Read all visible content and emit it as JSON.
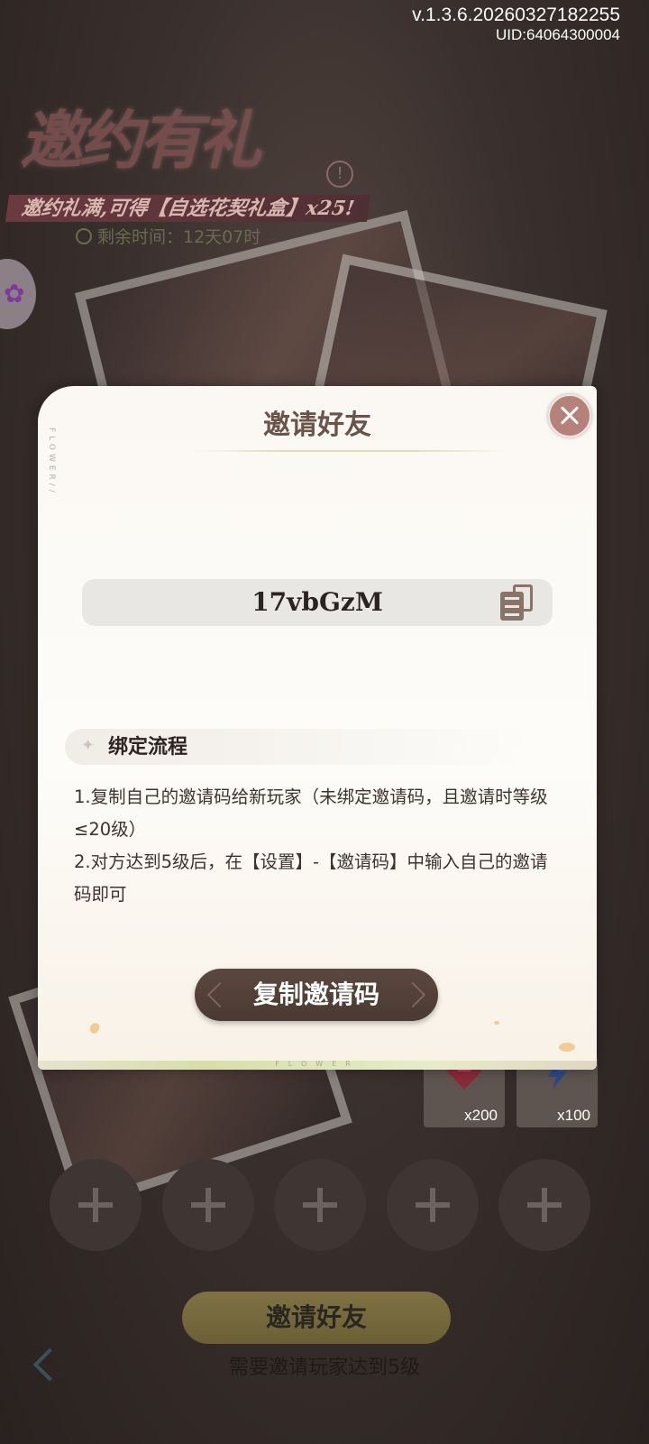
{
  "header": {
    "version": "v.1.3.6.20260327182255",
    "uid": "UID:64064300004"
  },
  "event": {
    "title": "邀约有礼",
    "info_mark": "!",
    "subtitle": "邀约礼满,可得【自选花契礼盒】x25!",
    "time_remaining": "剩余时间：12天07时"
  },
  "rewards": [
    {
      "icon": "ruby-gem-icon",
      "count": "x200"
    },
    {
      "icon": "lightning-icon",
      "count": "x100"
    }
  ],
  "invite_slots": [
    "+",
    "+",
    "+",
    "+",
    "+"
  ],
  "footer": {
    "invite_button": "邀请好友",
    "hint": "需要邀请玩家达到5级"
  },
  "dialog": {
    "title": "邀请好友",
    "invite_code": "17vbGzM",
    "section_title": "绑定流程",
    "rule_1": "1.复制自己的邀请码给新玩家（未绑定邀请码，且邀请时等级≤20级）",
    "rule_2": " 2.对方达到5级后，在【设置】-【邀请码】中输入自己的邀请码即可",
    "copy_button": "复制邀请码",
    "side_label": "FLOWER//",
    "bottom_label": "FLOWER"
  },
  "colors": {
    "accent_brown": "#4a3a33",
    "close_button": "#b5827a",
    "title_text": "#6b534b"
  }
}
